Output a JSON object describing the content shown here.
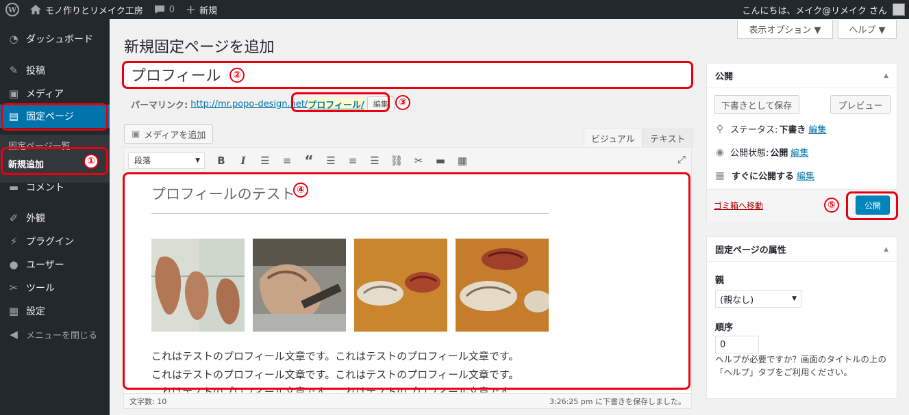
{
  "adminbar": {
    "site_name": "モノ作りとリメイク工房",
    "comments_count": "0",
    "new_label": "新規",
    "greeting": "こんにちは、メイク@リメイク さん"
  },
  "sidebar": {
    "dashboard": "ダッシュボード",
    "posts": "投稿",
    "media": "メディア",
    "pages": "固定ページ",
    "pages_all": "固定ページ一覧",
    "pages_new": "新規追加",
    "comments": "コメント",
    "appearance": "外観",
    "plugins": "プラグイン",
    "users": "ユーザー",
    "tools": "ツール",
    "settings": "設定",
    "collapse": "メニューを閉じる"
  },
  "header": {
    "screen_options": "表示オプション ▼",
    "help": "ヘルプ ▼",
    "title": "新規固定ページを追加"
  },
  "editor": {
    "title_value": "プロフィール",
    "permalink_label": "パーマリンク:",
    "permalink_url": "http://mr.popo-design.net/",
    "permalink_slug": "プロフィール/",
    "edit_slug": "編集",
    "add_media": "メディアを追加",
    "tab_visual": "ビジュアル",
    "tab_text": "テキスト",
    "format_select": "段落",
    "content_heading": "プロフィールのテスト",
    "paragraph_line": "これはテストのプロフィール文章です。これはテストのプロフィール文章です。",
    "word_count": "文字数: 10",
    "autosave": "3:26:25 pm に下書きを保存しました。"
  },
  "annotations": [
    "①",
    "②",
    "③",
    "④",
    "⑤"
  ],
  "publish_box": {
    "title": "公開",
    "save_draft": "下書きとして保存",
    "preview": "プレビュー",
    "status_label": "ステータス:",
    "status_value": "下書き",
    "visibility_label": "公開状態:",
    "visibility_value": "公開",
    "schedule_value": "すぐに公開する",
    "edit": "編集",
    "trash": "ゴミ箱へ移動",
    "publish": "公開"
  },
  "attributes_box": {
    "title": "固定ページの属性",
    "parent_label": "親",
    "parent_value": "(親なし)",
    "order_label": "順序",
    "order_value": "0",
    "help_text": "ヘルプが必要ですか？画面のタイトルの上の「ヘルプ」タブをご利用ください。"
  },
  "colors": {
    "admin_dark": "#23282d",
    "accent_blue": "#0073aa",
    "annotation_red": "#e8000f"
  }
}
